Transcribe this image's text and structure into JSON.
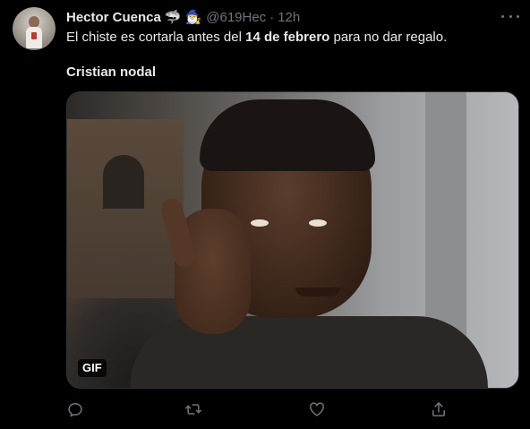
{
  "author": {
    "name": "Hector Cuenca",
    "emojis": [
      "🦈",
      "🧙‍♂️"
    ],
    "handle": "@619Hec",
    "separator": "·",
    "time": "12h"
  },
  "tweet": {
    "text_before": "El chiste es cortarla antes del ",
    "text_bold": "14 de febrero",
    "text_after": " para no dar regalo.",
    "line2": "Cristian nodal"
  },
  "media": {
    "badge": "GIF"
  },
  "actions": [
    {
      "icon": "reply-icon"
    },
    {
      "icon": "retweet-icon"
    },
    {
      "icon": "like-icon"
    },
    {
      "icon": "share-icon"
    }
  ],
  "colors": {
    "background": "#000000",
    "text": "#e7e9ea",
    "muted": "#71767b",
    "border": "#2f3336"
  }
}
